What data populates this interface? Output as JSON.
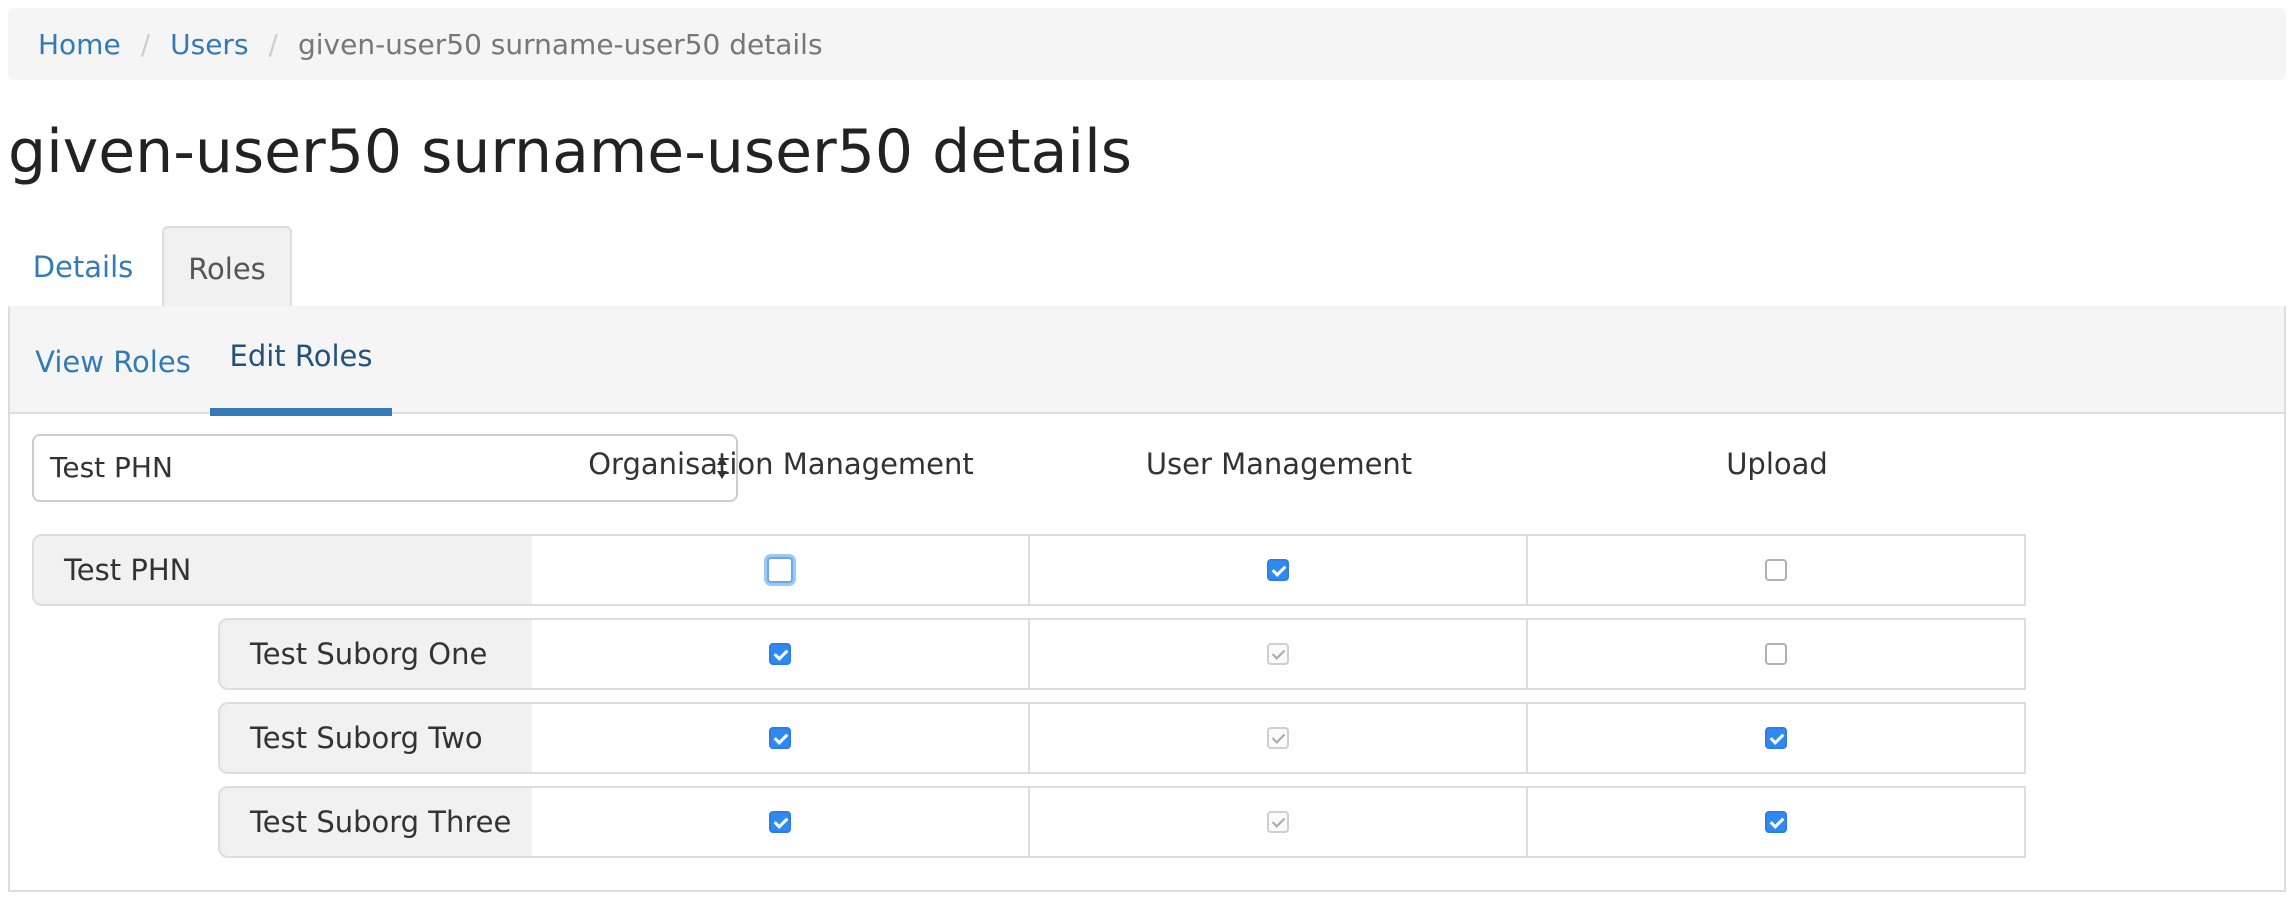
{
  "breadcrumb": {
    "home": "Home",
    "users": "Users",
    "current": "given-user50 surname-user50 details",
    "separator": "/"
  },
  "page_title": "given-user50 surname-user50 details",
  "tabs": {
    "details": "Details",
    "roles": "Roles",
    "active": "Roles"
  },
  "subtabs": {
    "view": "View Roles",
    "edit": "Edit Roles",
    "active": "Edit Roles"
  },
  "org_select": {
    "value": "Test PHN"
  },
  "columns": [
    "Organisation Management",
    "User Management",
    "Upload"
  ],
  "rows": [
    {
      "name": "Test PHN",
      "org_mgmt": false,
      "org_mgmt_focused": true,
      "user_mgmt": true,
      "user_mgmt_disabled": false,
      "upload": false
    },
    {
      "name": "Test Suborg One",
      "org_mgmt": true,
      "user_mgmt": true,
      "user_mgmt_disabled": true,
      "upload": false
    },
    {
      "name": "Test Suborg Two",
      "org_mgmt": true,
      "user_mgmt": true,
      "user_mgmt_disabled": true,
      "upload": true
    },
    {
      "name": "Test Suborg Three",
      "org_mgmt": true,
      "user_mgmt": true,
      "user_mgmt_disabled": true,
      "upload": true
    }
  ],
  "colors": {
    "link": "#337ab7",
    "checkbox_checked": "#2f89f5",
    "active_tab_underline": "#337ab7"
  }
}
